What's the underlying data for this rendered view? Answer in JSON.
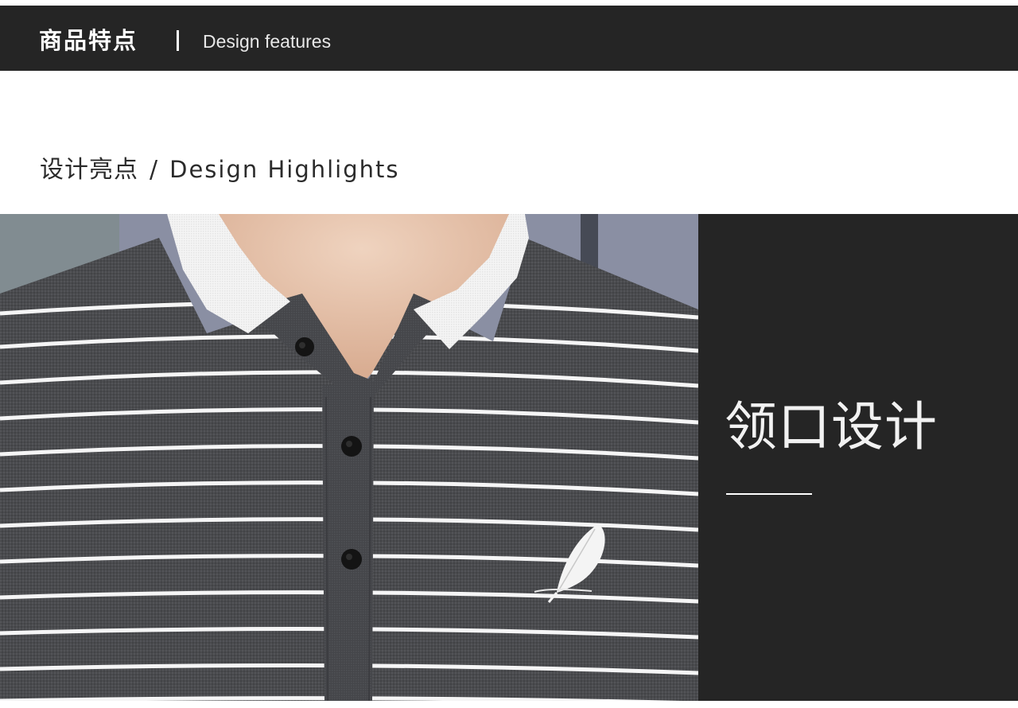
{
  "header": {
    "title_cn": "商品特点",
    "title_en": "Design features"
  },
  "section": {
    "title_cn": "设计亮点",
    "separator": "/",
    "title_en": "Design Highlights"
  },
  "feature": {
    "title": "领口设计"
  },
  "colors": {
    "dark_bar": "#252525",
    "fabric": "#4a4b4e",
    "stripe": "#ffffff",
    "collar": "#f4f4f4",
    "skin": "#e6c3ab",
    "background_wall": "#8a8fa3"
  },
  "icons": {
    "logo": "feather-icon"
  }
}
